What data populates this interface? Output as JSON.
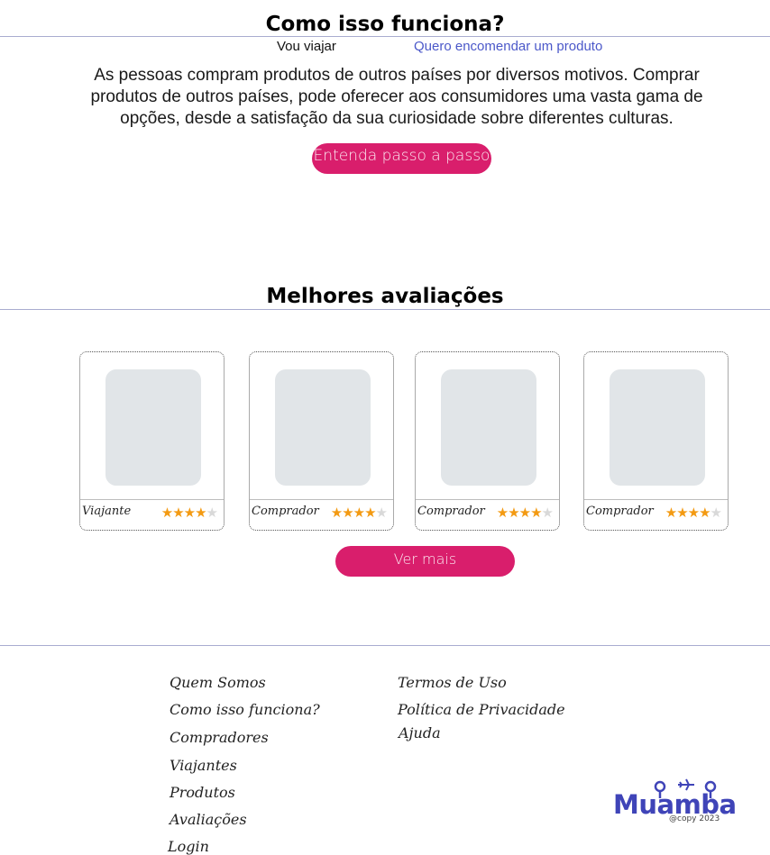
{
  "how_it_works": {
    "title": "Como isso funciona?",
    "tabs": [
      "Vou viajar",
      "Quero encomendar um produto"
    ],
    "description": "As pessoas compram produtos de outros países por diversos motivos. Comprar produtos de outros países, pode oferecer aos consumidores uma vasta gama de opções, desde a satisfação da sua curiosidade sobre diferentes culturas.",
    "cta_label": "Entenda passo a passo"
  },
  "reviews": {
    "title": "Melhores avaliações",
    "cards": [
      {
        "role": "Viajante",
        "rating": 4,
        "max": 5
      },
      {
        "role": "Comprador",
        "rating": 4,
        "max": 5
      },
      {
        "role": "Comprador",
        "rating": 4,
        "max": 5
      },
      {
        "role": "Comprador",
        "rating": 4,
        "max": 5
      }
    ],
    "more_label": "Ver mais"
  },
  "footer": {
    "col1": [
      "Quem Somos",
      "Como isso funciona?",
      "Compradores",
      "Viajantes",
      "Produtos",
      "Avaliações",
      "Login"
    ],
    "col2": [
      "Termos de Uso",
      "Política de Privacidade",
      "Ajuda"
    ],
    "logo_text": "Muamba",
    "copyright": "@copy 2023"
  },
  "colors": {
    "accent": "#d91e6c",
    "link": "#4b58c9",
    "brand": "#3f44b8",
    "star": "#f39a12"
  }
}
